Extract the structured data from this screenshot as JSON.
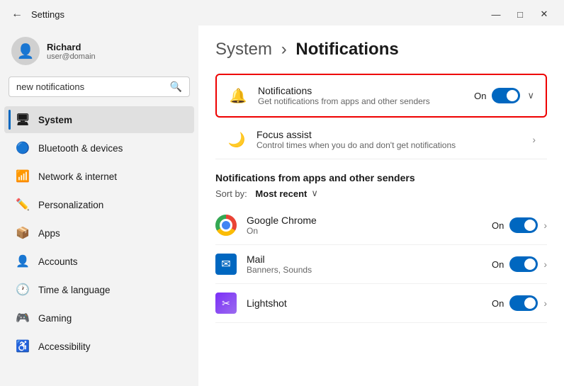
{
  "titlebar": {
    "back_label": "←",
    "title": "Settings",
    "minimize_label": "—",
    "maximize_label": "□",
    "close_label": "✕"
  },
  "sidebar": {
    "user": {
      "name": "Richard",
      "sub": "user@domain"
    },
    "search": {
      "value": "new notifications",
      "placeholder": "new notifications"
    },
    "items": [
      {
        "id": "system",
        "label": "System",
        "icon": "🖥",
        "active": true
      },
      {
        "id": "bluetooth",
        "label": "Bluetooth & devices",
        "icon": "🔵"
      },
      {
        "id": "network",
        "label": "Network & internet",
        "icon": "📶"
      },
      {
        "id": "personalization",
        "label": "Personalization",
        "icon": "✏️"
      },
      {
        "id": "apps",
        "label": "Apps",
        "icon": "📦"
      },
      {
        "id": "accounts",
        "label": "Accounts",
        "icon": "👤"
      },
      {
        "id": "time",
        "label": "Time & language",
        "icon": "🕐"
      },
      {
        "id": "gaming",
        "label": "Gaming",
        "icon": "🎮"
      },
      {
        "id": "accessibility",
        "label": "Accessibility",
        "icon": "♿"
      }
    ]
  },
  "content": {
    "breadcrumb": {
      "parent": "System",
      "separator": "›",
      "current": "Notifications"
    },
    "notifications_card": {
      "title": "Notifications",
      "subtitle": "Get notifications from apps and other senders",
      "status": "On",
      "toggle": "on"
    },
    "focus_assist": {
      "title": "Focus assist",
      "subtitle": "Control times when you do and don't get notifications",
      "toggle": null
    },
    "apps_section": {
      "header": "Notifications from apps and other senders",
      "sort_label": "Sort by:",
      "sort_value": "Most recent",
      "apps": [
        {
          "name": "Google Chrome",
          "sub": "On",
          "status": "On",
          "toggle": "on",
          "icon_type": "chrome"
        },
        {
          "name": "Mail",
          "sub": "Banners, Sounds",
          "status": "On",
          "toggle": "on",
          "icon_type": "mail"
        },
        {
          "name": "Lightshot",
          "sub": "",
          "status": "On",
          "toggle": "on",
          "icon_type": "lightshot"
        }
      ]
    }
  }
}
